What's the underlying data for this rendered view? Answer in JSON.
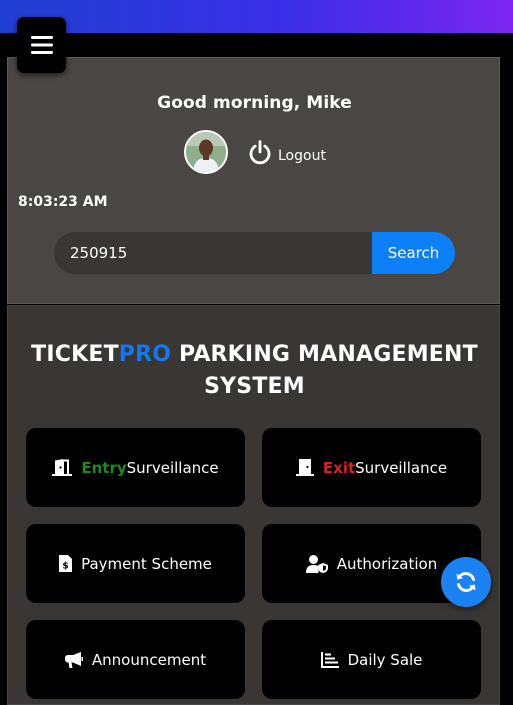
{
  "header": {
    "accent_gradient": [
      "#1f3fd0",
      "#3a2ee8",
      "#7b26f0"
    ],
    "menu_icon": "hamburger-icon"
  },
  "user": {
    "greeting": "Good morning, Mike",
    "logout_label": "Logout",
    "time": "8:03:23 AM"
  },
  "search": {
    "value": "250915",
    "button_label": "Search"
  },
  "system": {
    "title_part1": "TICKET",
    "title_part2": "PRO",
    "title_part3": " PARKING MANAGEMENT SYSTEM"
  },
  "tiles": {
    "entry": {
      "highlight": "Entry",
      "label": "Surveillance",
      "icon": "door-open-icon"
    },
    "exit": {
      "highlight": "Exit",
      "label": "Surveillance",
      "icon": "door-closed-icon"
    },
    "payment": {
      "label": "Payment Scheme",
      "icon": "invoice-icon"
    },
    "authorization": {
      "label": "Authorization",
      "icon": "user-shield-icon"
    },
    "announcement": {
      "label": "Announcement",
      "icon": "bullhorn-icon"
    },
    "daily_sale": {
      "label": "Daily Sale",
      "icon": "bar-chart-icon"
    }
  },
  "fab": {
    "icon": "refresh-icon"
  },
  "colors": {
    "primary_blue": "#0d7ff7",
    "entry_green": "#1e8a1e",
    "exit_red": "#d42121",
    "pro_blue": "#1677e8"
  }
}
